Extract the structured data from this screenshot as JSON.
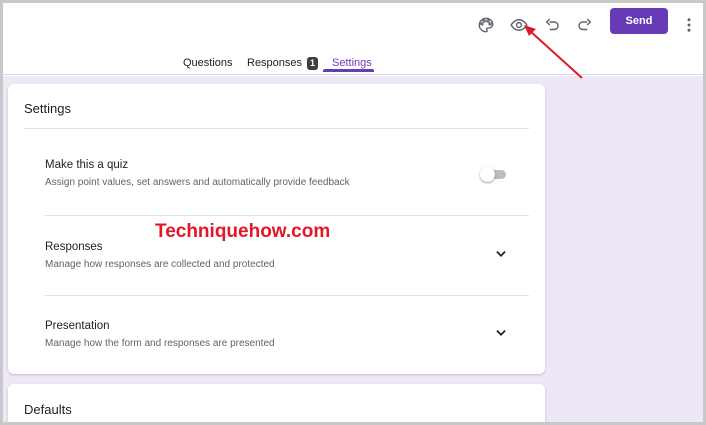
{
  "toolbar": {
    "icons": [
      "palette-icon",
      "preview-eye-icon",
      "undo-icon",
      "redo-icon",
      "more-vert-icon"
    ],
    "send_label": "Send",
    "accent": "#673ab7"
  },
  "tabs": [
    {
      "label": "Questions"
    },
    {
      "label": "Responses",
      "badge": "1"
    },
    {
      "label": "Settings",
      "active": true
    }
  ],
  "settings_card": {
    "title": "Settings",
    "rows": [
      {
        "title": "Make this a quiz",
        "subtitle": "Assign point values, set answers and automatically provide feedback",
        "control": "toggle",
        "toggle_on": false
      },
      {
        "title": "Responses",
        "subtitle": "Manage how responses are collected and protected",
        "control": "chevron-down-icon"
      },
      {
        "title": "Presentation",
        "subtitle": "Manage how the form and responses are presented",
        "control": "chevron-down-icon"
      }
    ]
  },
  "defaults_card": {
    "title": "Defaults"
  },
  "watermark": "Techniquehow.com",
  "colors": {
    "background": "#ede7f6",
    "annotation_arrow": "#e1182a"
  }
}
